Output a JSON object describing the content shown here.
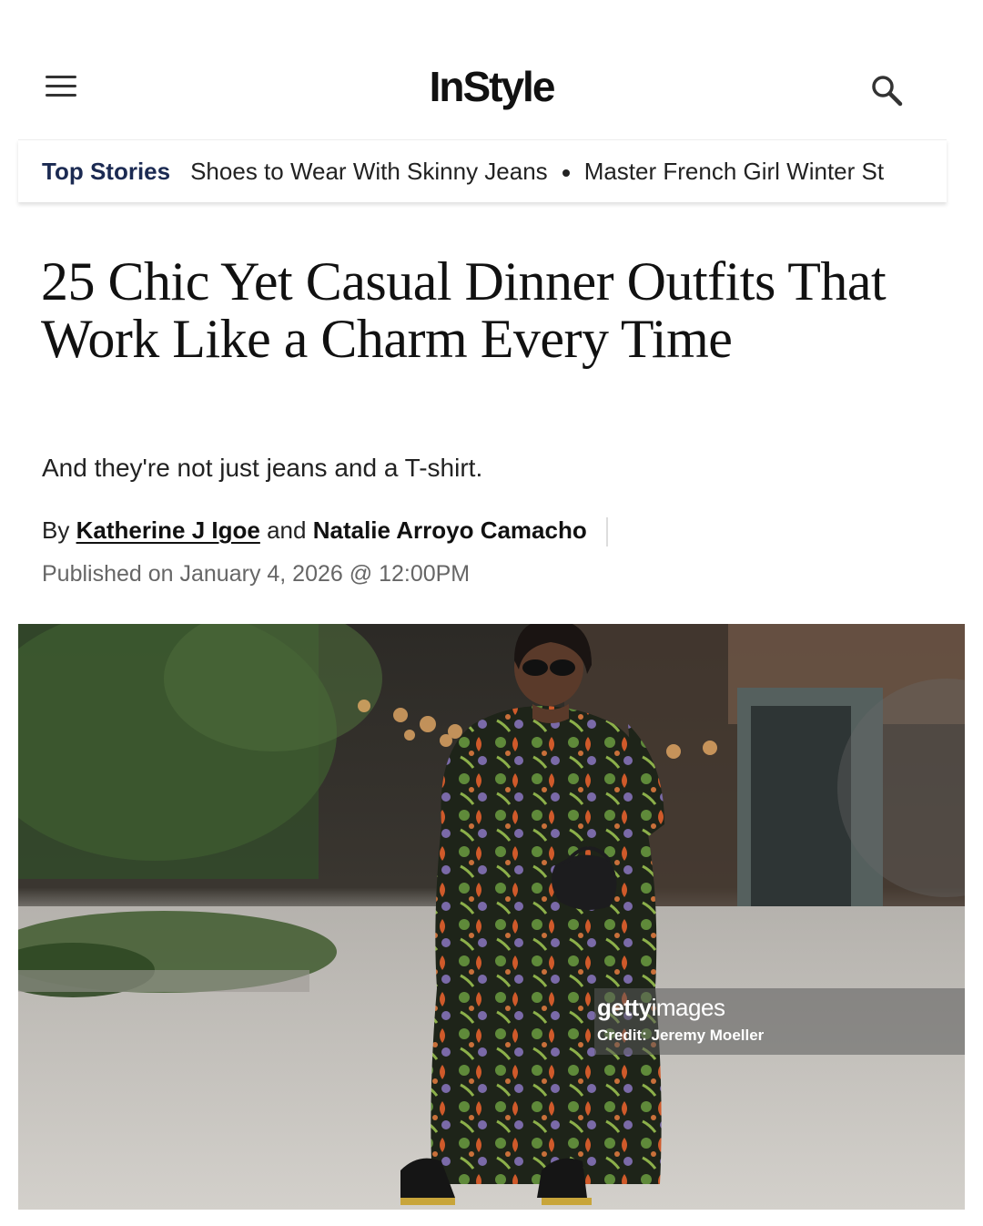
{
  "header": {
    "logo": "InStyle",
    "menu_icon": "hamburger-menu-icon",
    "search_icon": "search-icon"
  },
  "top_stories": {
    "label": "Top Stories",
    "links": [
      "Shoes to Wear With Skinny Jeans",
      "Master French Girl Winter St"
    ]
  },
  "article": {
    "title": "25 Chic Yet Casual Dinner Outfits That Work Like a Charm Every Time",
    "subtitle": "And they're not just jeans and a T-shirt.",
    "byline_prefix": "By",
    "author1": "Katherine J Igoe",
    "and": "and",
    "author2": "Natalie Arroyo Camacho",
    "published": "Published on January 4, 2026 @ 12:00PM"
  },
  "hero_image": {
    "watermark_brand_bold": "getty",
    "watermark_brand": "images",
    "credit": "Credit: Jeremy Moeller"
  },
  "colors": {
    "top_stories_label": "#1b2a52",
    "text": "#111111",
    "muted": "#666666"
  }
}
